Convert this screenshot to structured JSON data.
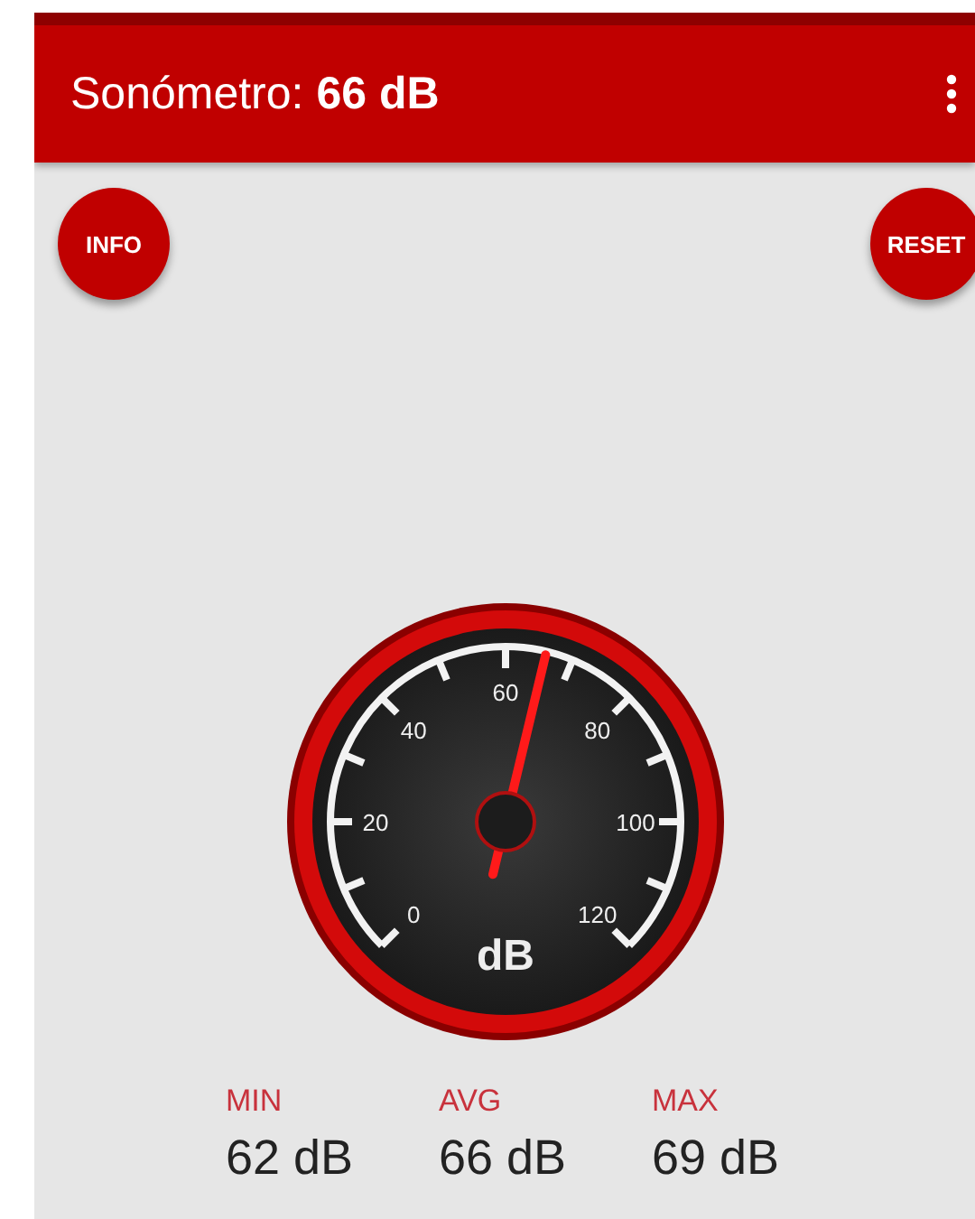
{
  "app_bar": {
    "title": "Sonómetro: ",
    "reading": "66 dB"
  },
  "buttons": [
    {
      "label": "INFO"
    },
    {
      "label": "RESET"
    }
  ],
  "gauge": {
    "unit": "dB",
    "scale": [
      "0",
      "20",
      "40",
      "60",
      "80",
      "100",
      "120"
    ]
  },
  "stats": [
    {
      "label": "MIN",
      "value": "62 dB"
    },
    {
      "label": "AVG",
      "value": "66 dB"
    },
    {
      "label": "MAX",
      "value": "69 dB"
    }
  ]
}
